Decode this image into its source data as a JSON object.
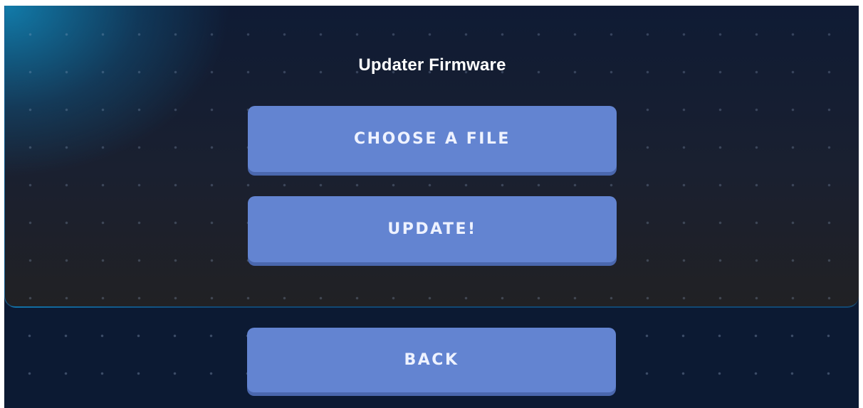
{
  "app": {
    "title": "Updater Firmware"
  },
  "buttons": {
    "choose_file": "CHOOSE A FILE",
    "update": "UPDATE!",
    "back": "BACK"
  },
  "colors": {
    "background": "#0c1a33",
    "button": "#6384d1",
    "button_shadow": "#4a67ad",
    "accent_glow": "#128cbe",
    "title_text": "#ffffff"
  }
}
